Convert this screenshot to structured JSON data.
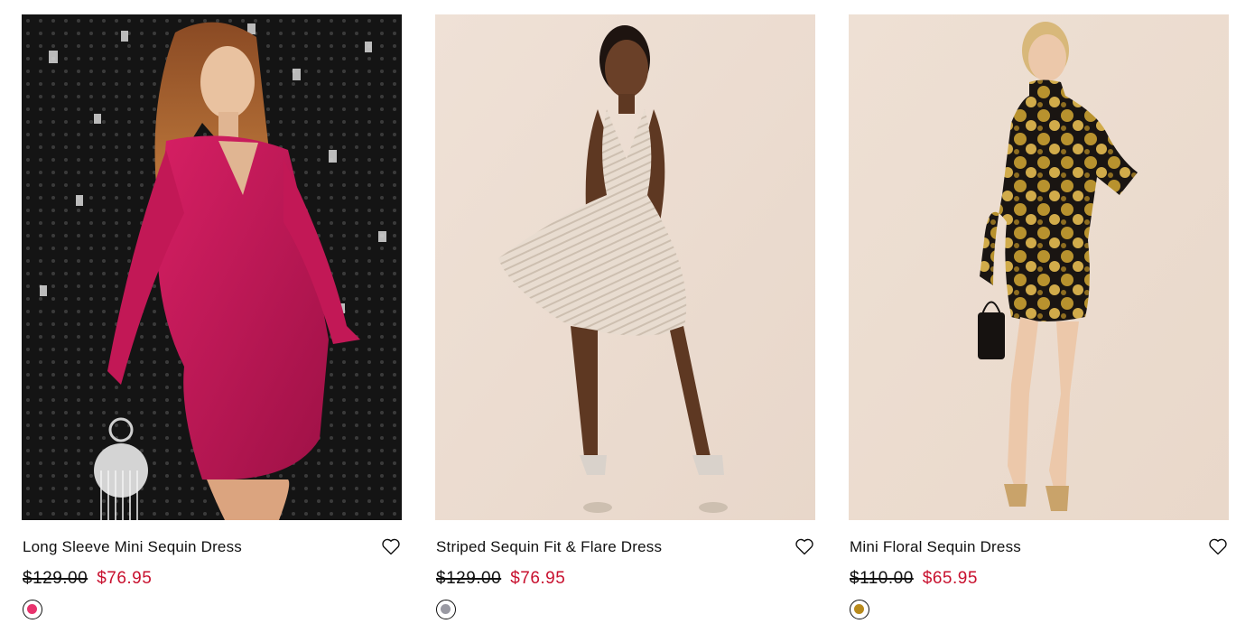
{
  "products": [
    {
      "name": "Long Sleeve Mini Sequin Dress",
      "original_price": "$129.00",
      "sale_price": "$76.95",
      "swatch_color": "#e8336d",
      "image_alt": "Long Sleeve Mini Sequin Dress",
      "wishlist_icon": "heart-outline-icon"
    },
    {
      "name": "Striped Sequin Fit & Flare Dress",
      "original_price": "$129.00",
      "sale_price": "$76.95",
      "swatch_color": "#9a9aa3",
      "image_alt": "Striped Sequin Fit & Flare Dress",
      "wishlist_icon": "heart-outline-icon"
    },
    {
      "name": "Mini Floral Sequin Dress",
      "original_price": "$110.00",
      "sale_price": "$65.95",
      "swatch_color": "#b88a1c",
      "image_alt": "Mini Floral Sequin Dress",
      "wishlist_icon": "heart-outline-icon"
    }
  ],
  "colors": {
    "sale": "#c8102e",
    "text": "#111111"
  }
}
